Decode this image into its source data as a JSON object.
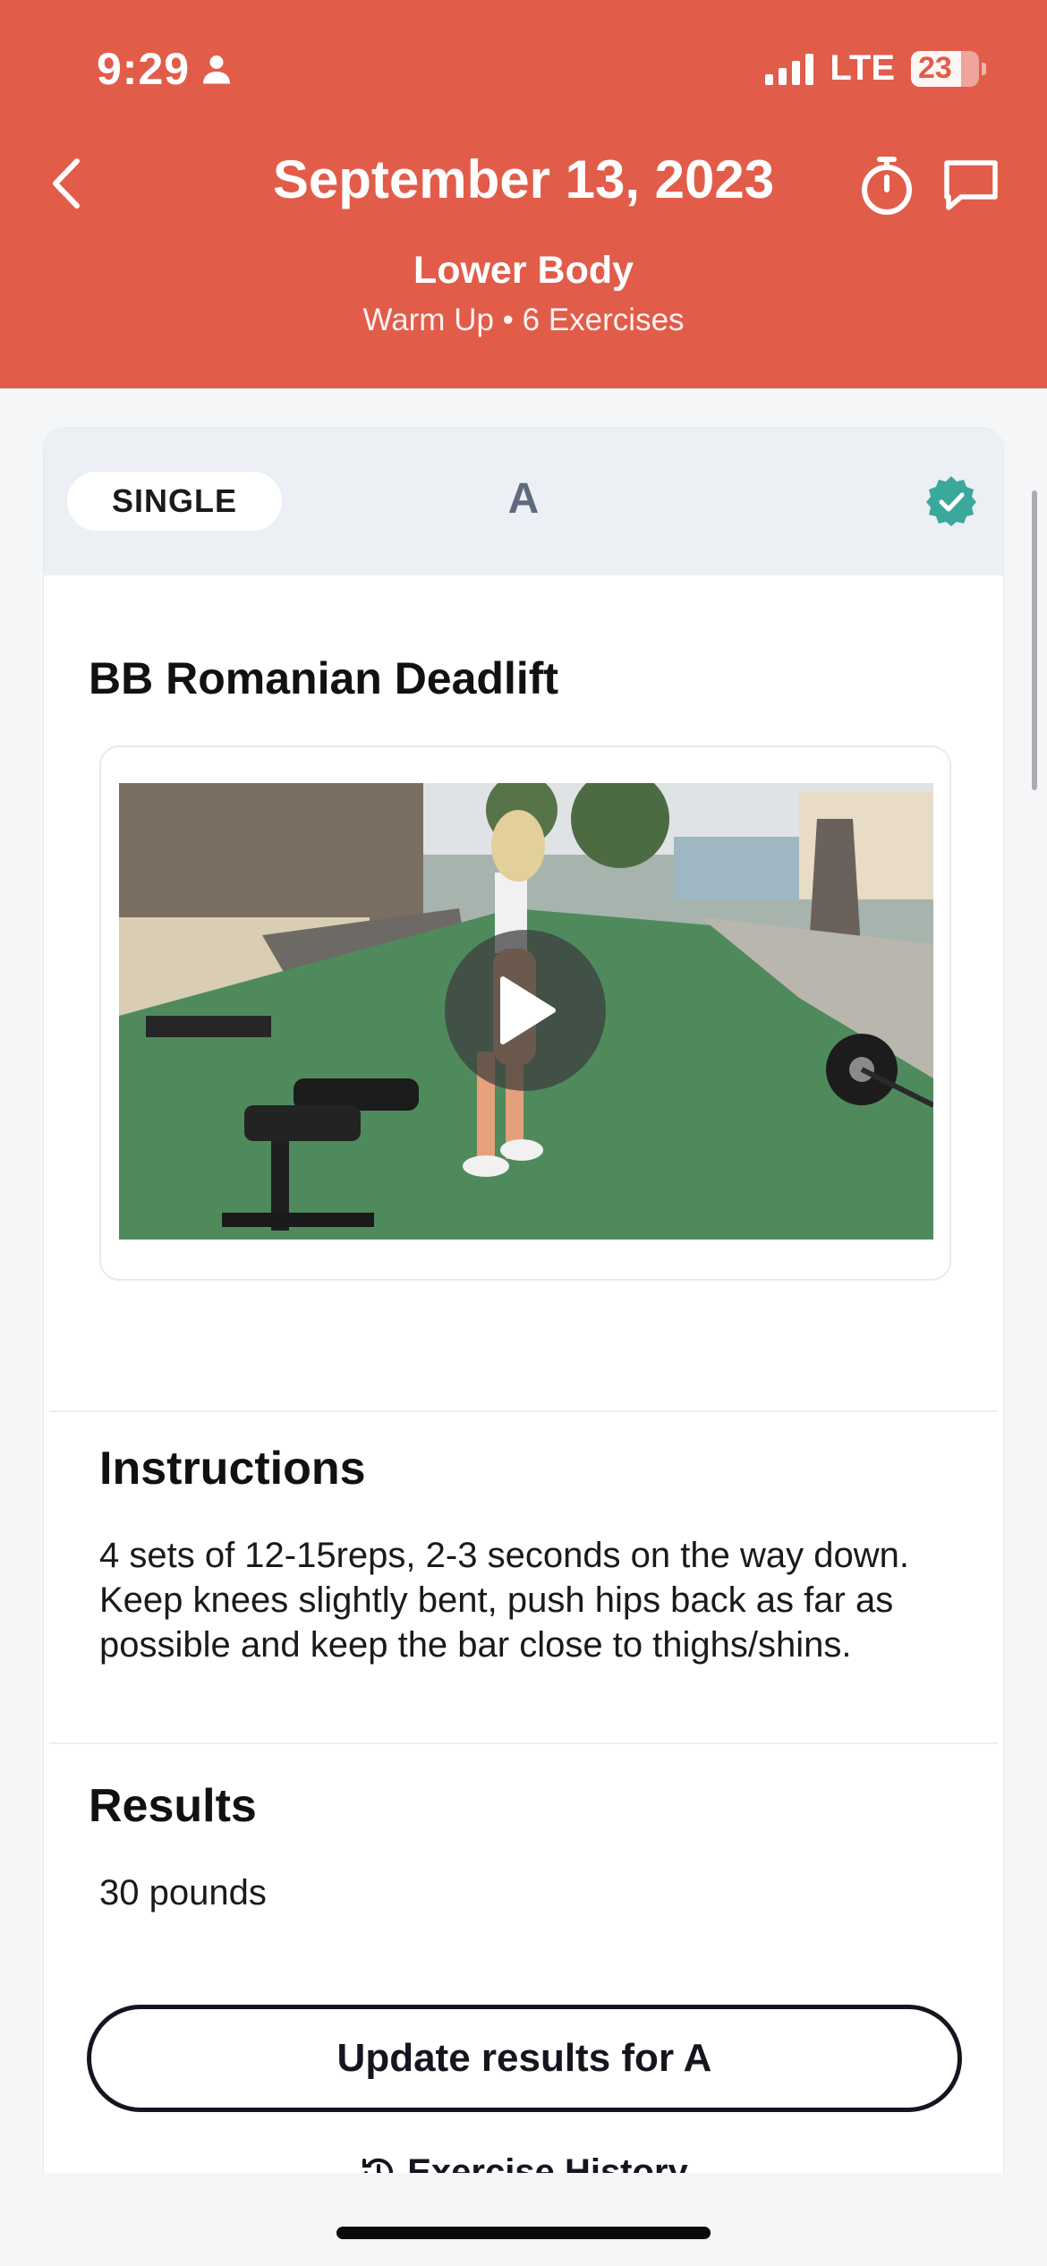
{
  "status_bar": {
    "time": "9:29",
    "network": "LTE",
    "battery": "23"
  },
  "header": {
    "title": "September 13, 2023",
    "workout_name": "Lower Body",
    "workout_meta": "Warm Up • 6 Exercises",
    "color": "#e25c4a"
  },
  "card": {
    "type_label": "SINGLE",
    "block_letter": "A",
    "completed": true,
    "check_color": "#3aa89a"
  },
  "exercise": {
    "name": "BB Romanian Deadlift",
    "instructions_title": "Instructions",
    "instructions": "4 sets of 12-15reps, 2-3 seconds on the way down. Keep knees slightly bent, push hips back as far as possible and keep the bar close to thighs/shins.",
    "results_title": "Results",
    "results_value": "30 pounds",
    "update_button": "Update results for A",
    "history_link": "Exercise History"
  },
  "icons": [
    "person-icon",
    "signal-icon",
    "battery-icon",
    "back-chevron-icon",
    "stopwatch-icon",
    "chat-icon",
    "verified-check-icon",
    "play-icon",
    "history-icon"
  ]
}
